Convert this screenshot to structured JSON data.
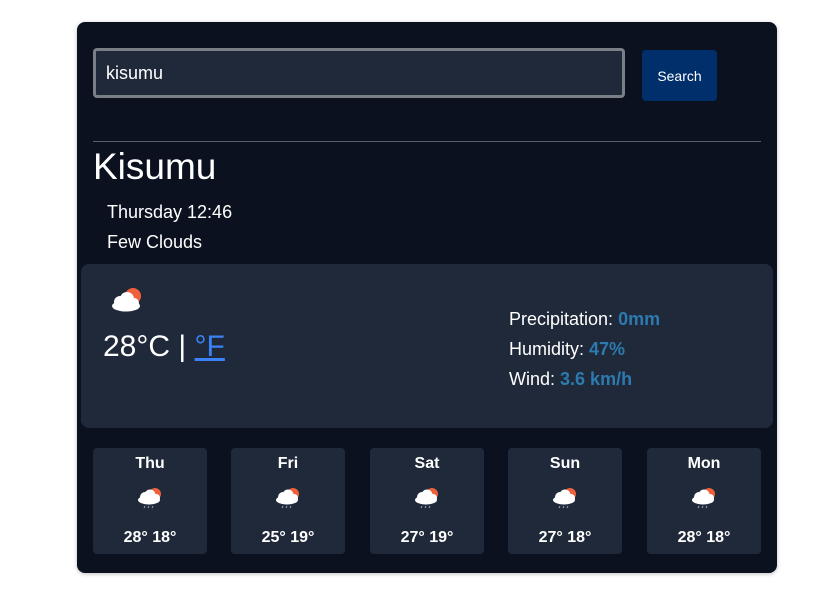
{
  "search": {
    "value": "kisumu",
    "button_label": "Search"
  },
  "location": {
    "city": "Kisumu",
    "datetime": "Thursday 12:46",
    "description": "Few Clouds"
  },
  "current": {
    "icon": "cloud-sun-icon",
    "temperature": "28",
    "unit_celsius": "°C",
    "separator": "|",
    "unit_fahrenheit": "°F",
    "precipitation_label": "Precipitation:",
    "precipitation": "0mm",
    "humidity_label": "Humidity:",
    "humidity": "47%",
    "wind_label": "Wind:",
    "wind": "3.6 km/h"
  },
  "forecast": [
    {
      "day": "Thu",
      "max": "28°",
      "min": "18°",
      "icon": "cloud-sun-rain-icon"
    },
    {
      "day": "Fri",
      "max": "25°",
      "min": "19°",
      "icon": "cloud-sun-rain-icon"
    },
    {
      "day": "Sat",
      "max": "27°",
      "min": "19°",
      "icon": "cloud-sun-rain-icon"
    },
    {
      "day": "Sun",
      "max": "27°",
      "min": "18°",
      "icon": "cloud-sun-rain-icon"
    },
    {
      "day": "Mon",
      "max": "28°",
      "min": "18°",
      "icon": "cloud-sun-rain-icon"
    }
  ],
  "colors": {
    "background": "#0b111e",
    "panel": "#1f293a",
    "button": "#002f6b",
    "link": "#3b82f6",
    "stat_value": "#2c7ab0",
    "sun": "#f0603a"
  }
}
